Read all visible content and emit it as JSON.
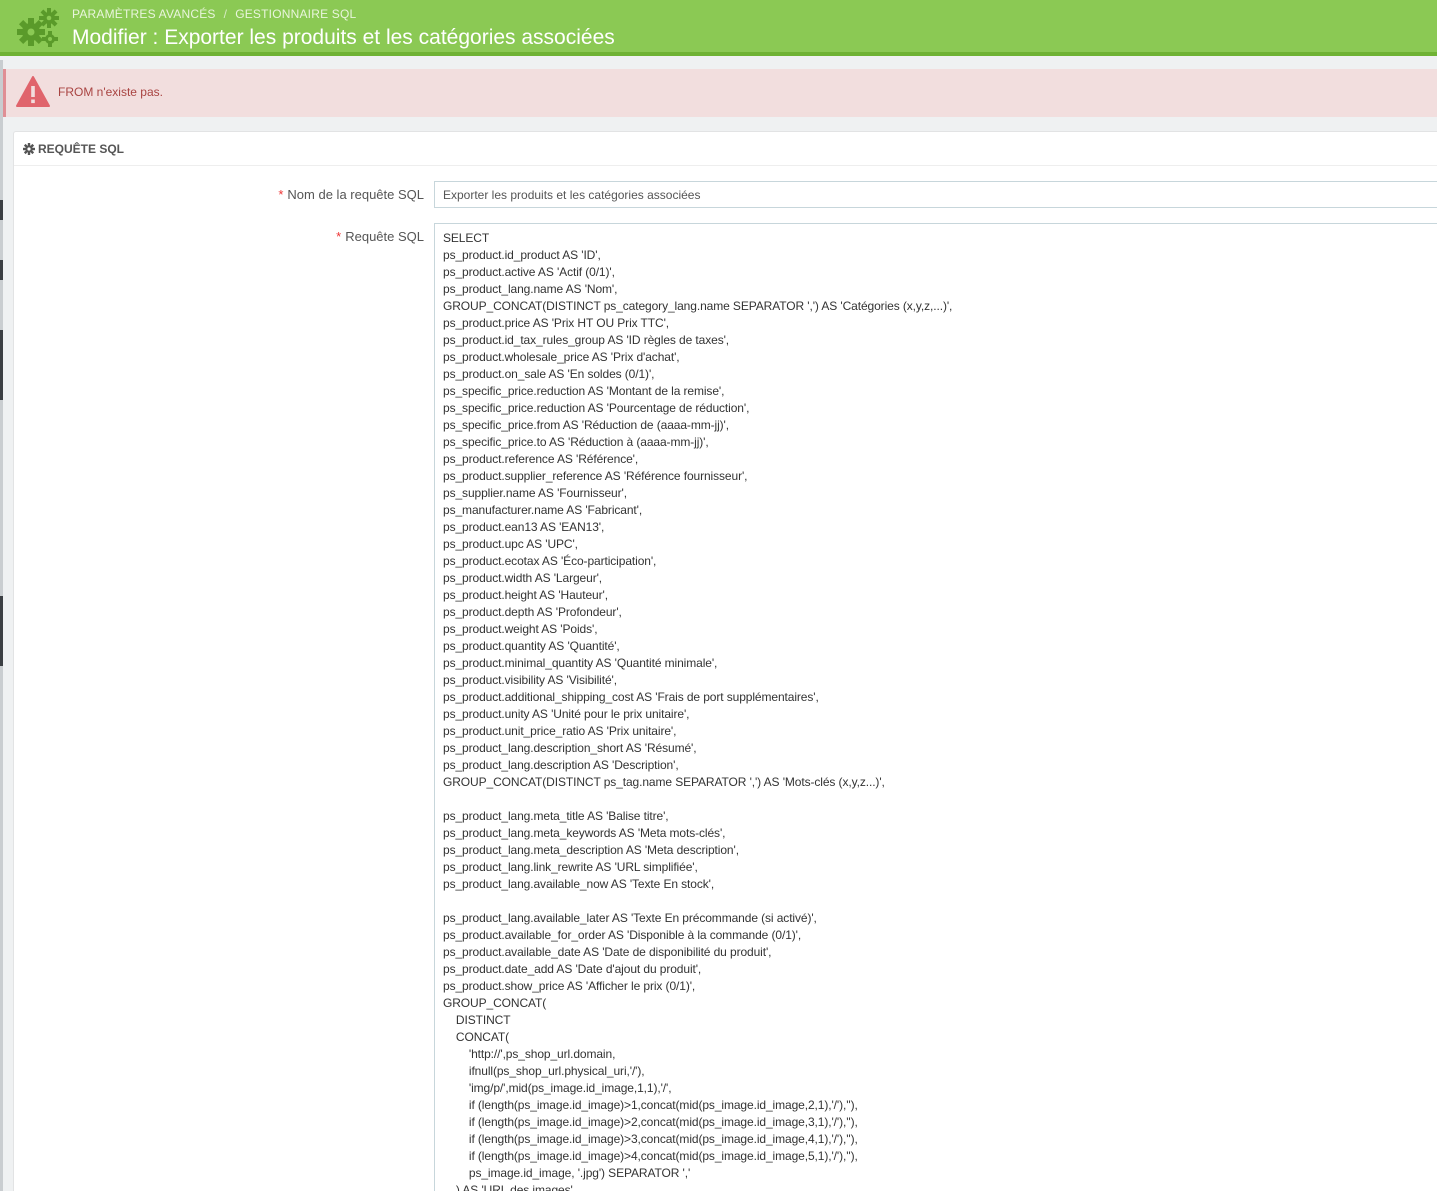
{
  "header": {
    "breadcrumb": [
      "PARAMÈTRES AVANCÉS",
      "GESTIONNAIRE SQL"
    ],
    "breadcrumb_separator": "/",
    "title": "Modifier : Exporter les produits et les catégories associées",
    "bg_color": "#8bc954"
  },
  "alert": {
    "message": "FROM n'existe pas.",
    "icon": "warning-triangle-icon",
    "color": "#a94442"
  },
  "panel": {
    "heading": "REQUÊTE SQL",
    "heading_icon": "gear-icon"
  },
  "form": {
    "required_mark": "*",
    "name_label": "Nom de la requête SQL",
    "name_value": "Exporter les produits et les catégories associées",
    "sql_label": "Requête SQL",
    "sql_value": "SELECT\nps_product.id_product AS 'ID',\nps_product.active AS 'Actif (0/1)',\nps_product_lang.name AS 'Nom',\nGROUP_CONCAT(DISTINCT ps_category_lang.name SEPARATOR ',') AS 'Catégories (x,y,z,...)',\nps_product.price AS 'Prix HT OU Prix TTC',\nps_product.id_tax_rules_group AS 'ID règles de taxes',\nps_product.wholesale_price AS 'Prix d'achat',\nps_product.on_sale AS 'En soldes (0/1)',\nps_specific_price.reduction AS 'Montant de la remise',\nps_specific_price.reduction AS 'Pourcentage de réduction',\nps_specific_price.from AS 'Réduction de (aaaa-mm-jj)',\nps_specific_price.to AS 'Réduction à (aaaa-mm-jj)',\nps_product.reference AS 'Référence',\nps_product.supplier_reference AS 'Référence fournisseur',\nps_supplier.name AS 'Fournisseur',\nps_manufacturer.name AS 'Fabricant',\nps_product.ean13 AS 'EAN13',\nps_product.upc AS 'UPC',\nps_product.ecotax AS 'Éco-participation',\nps_product.width AS 'Largeur',\nps_product.height AS 'Hauteur',\nps_product.depth AS 'Profondeur',\nps_product.weight AS 'Poids',\nps_product.quantity AS 'Quantité',\nps_product.minimal_quantity AS 'Quantité minimale',\nps_product.visibility AS 'Visibilité',\nps_product.additional_shipping_cost AS 'Frais de port supplémentaires',\nps_product.unity AS 'Unité pour le prix unitaire',\nps_product.unit_price_ratio AS 'Prix unitaire',\nps_product_lang.description_short AS 'Résumé',\nps_product_lang.description AS 'Description',\nGROUP_CONCAT(DISTINCT ps_tag.name SEPARATOR ',') AS 'Mots-clés (x,y,z...)',\n\nps_product_lang.meta_title AS 'Balise titre',\nps_product_lang.meta_keywords AS 'Meta mots-clés',\nps_product_lang.meta_description AS 'Meta description',\nps_product_lang.link_rewrite AS 'URL simplifiée',\nps_product_lang.available_now AS 'Texte En stock',\n\nps_product_lang.available_later AS 'Texte En précommande (si activé)',\nps_product.available_for_order AS 'Disponible à la commande (0/1)',\nps_product.available_date AS 'Date de disponibilité du produit',\nps_product.date_add AS 'Date d'ajout du produit',\nps_product.show_price AS 'Afficher le prix (0/1)',\nGROUP_CONCAT(\n    DISTINCT\n    CONCAT(\n        'http://',ps_shop_url.domain,\n        ifnull(ps_shop_url.physical_uri,'/'),\n        'img/p/',mid(ps_image.id_image,1,1),'/',\n        if (length(ps_image.id_image)>1,concat(mid(ps_image.id_image,2,1),'/'),''),\n        if (length(ps_image.id_image)>2,concat(mid(ps_image.id_image,3,1),'/'),''),\n        if (length(ps_image.id_image)>3,concat(mid(ps_image.id_image,4,1),'/'),''),\n        if (length(ps_image.id_image)>4,concat(mid(ps_image.id_image,5,1),'/'),''),\n        ps_image.id_image, '.jpg') SEPARATOR ','\n    ) AS 'URL des images'"
  }
}
